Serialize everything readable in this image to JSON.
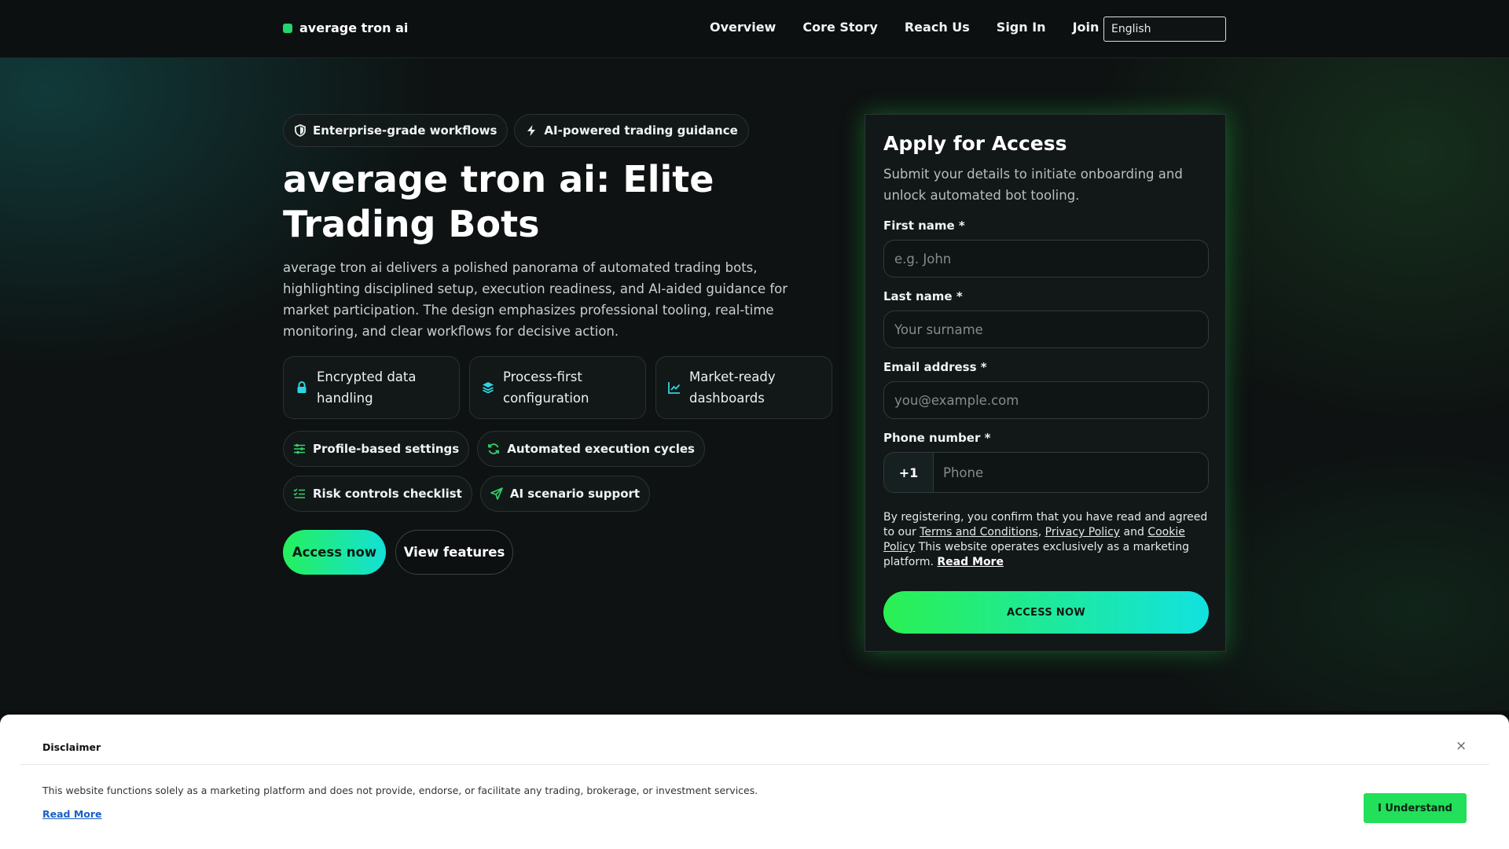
{
  "header": {
    "brand": "average tron ai",
    "nav": [
      "Overview",
      "Core Story",
      "Reach Us",
      "Sign In",
      "Join Now"
    ],
    "language": "English"
  },
  "hero": {
    "chips": [
      "Enterprise-grade workflows",
      "AI-powered trading guidance"
    ],
    "title": "average tron ai: Elite Trading Bots",
    "lead": "average tron ai delivers a polished panorama of automated trading bots, highlighting disciplined setup, execution readiness, and AI-aided guidance for market participation. The design emphasizes professional tooling, real-time monitoring, and clear workflows for decisive action.",
    "cards": [
      "Encrypted data handling",
      "Process-first configuration",
      "Market-ready dashboards"
    ],
    "pills_row1": [
      "Profile-based settings",
      "Automated execution cycles"
    ],
    "pills_row2": [
      "Risk controls checklist",
      "AI scenario support"
    ],
    "cta_primary": "Access now",
    "cta_secondary": "View features"
  },
  "form": {
    "title": "Apply for Access",
    "subtitle": "Submit your details to initiate onboarding and unlock automated bot tooling.",
    "first_name_label": "First name *",
    "first_name_placeholder": "e.g. John",
    "last_name_label": "Last name *",
    "last_name_placeholder": "Your surname",
    "email_label": "Email address *",
    "email_placeholder": "you@example.com",
    "phone_label": "Phone number *",
    "phone_code": "+1",
    "phone_placeholder": "Phone",
    "consent_1": "By registering, you confirm that you have read and agreed to our ",
    "terms": "Terms and Conditions",
    "sep_comma": ", ",
    "privacy": "Privacy Policy",
    "and": " and ",
    "cookie": "Cookie Policy",
    "consent_2": " This website operates exclusively as a marketing platform. ",
    "read_more": "Read More",
    "submit": "ACCESS NOW"
  },
  "disclaimer": {
    "title": "Disclaimer",
    "close": "×",
    "text": "This website functions solely as a marketing platform and does not provide, endorse, or facilitate any trading, brokerage, or investment services.",
    "read_more": "Read More",
    "accept": "I Understand"
  },
  "colors": {
    "accent_green": "#22d66f",
    "accent_cyan": "#13e0d6",
    "icon_green": "#35d26b",
    "icon_cyan": "#2fd4e0"
  }
}
